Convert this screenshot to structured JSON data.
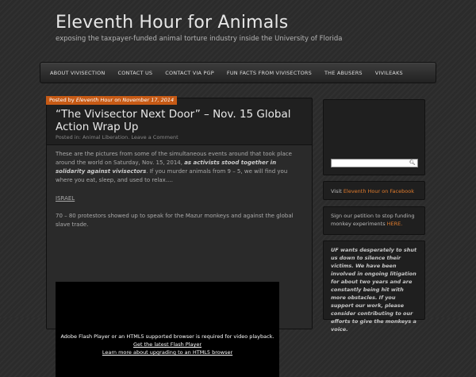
{
  "site": {
    "title": "Eleventh Hour for Animals",
    "tagline": "exposing the taxpayer-funded animal torture industry inside the University of Florida"
  },
  "nav": {
    "items": [
      "ABOUT VIVISECTION",
      "CONTACT US",
      "CONTACT VIA PGP",
      "FUN FACTS FROM VIVISECTORS",
      "THE ABUSERS",
      "VIVILEAKS"
    ]
  },
  "post": {
    "meta_prefix": "Posted by ",
    "author": "Eleventh Hour",
    "meta_on": " on ",
    "date": "November 17, 2014",
    "title": "“The Vivisector Next Door” – Nov. 15 Global Action Wrap Up",
    "posted_in": "Posted in: ",
    "category": "Animal Liberation",
    "separator": ". ",
    "comment_link": "Leave a Comment",
    "para1_start": "These are the pictures from some of the simultaneous events around that took place around the world on Saturday, Nov. 15, 2014, ",
    "para1_bold": "as activists stood together in solidarity against vivisectors",
    "para1_end": ". If you murder animals from 9 – 5, we will find you where you eat, sleep, and used to relax.…",
    "israel": "ISRAEL",
    "para2": "70 – 80 protestors showed up to speak for the Mazur monkeys and against the global slave trade.",
    "video": {
      "message": "Adobe Flash Player or an HTML5 supported browser is required for video playback.",
      "link1": "Get the latest Flash Player",
      "link2": "Learn more about upgrading to an HTML5 browser"
    }
  },
  "sidebar": {
    "visit_prefix": "Visit ",
    "facebook_link": "Eleventh Hour on Facebook",
    "petition_text": "Sign our petition to stop funding monkey experiments ",
    "petition_link": "HERE.",
    "uf_text": "UF wants desperately to shut us down to silence their victims. We have been involved in ongoing litigation for about two years and are constantly being hit with more obstacles. If you support our work, please consider contributing to our efforts to give the monkeys a voice."
  },
  "colors": {
    "accent": "#c65a15",
    "link_orange": "#e07b2c",
    "background": "#2b2b2b"
  }
}
